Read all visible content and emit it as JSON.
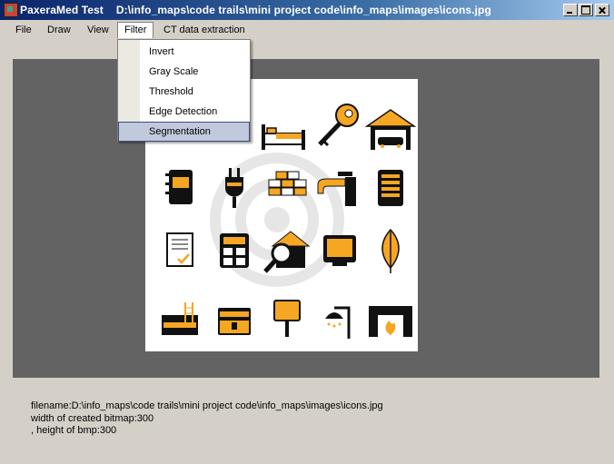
{
  "window": {
    "app_name": "PaxeraMed Test",
    "file_path": "D:\\info_maps\\code trails\\mini project code\\info_maps\\images\\icons.jpg"
  },
  "menu": {
    "items": [
      {
        "label": "File"
      },
      {
        "label": "Draw"
      },
      {
        "label": "View"
      },
      {
        "label": "Filter"
      },
      {
        "label": "CT data extraction"
      }
    ],
    "active": "Filter"
  },
  "filter_menu": {
    "items": [
      {
        "label": "Invert"
      },
      {
        "label": "Gray Scale"
      },
      {
        "label": "Threshold"
      },
      {
        "label": "Edge Detection"
      },
      {
        "label": "Segmentation"
      }
    ],
    "highlighted": "Segmentation"
  },
  "status": {
    "filename_line": "filename:D:\\info_maps\\code trails\\mini project code\\info_maps\\images\\icons.jpg",
    "width_line": "width of created bitmap:300",
    "height_line": ", height of bmp:300"
  },
  "image_icons": [
    "bed-icon",
    "key-icon",
    "garage-car-icon",
    "notebook-icon",
    "power-plug-icon",
    "bricks-icon",
    "faucet-icon",
    "radiator-icon",
    "document-check-icon",
    "calculator-icon",
    "house-search-icon",
    "television-icon",
    "leaf-icon",
    "toolbox-ladder-icon",
    "treasure-chest-icon",
    "signpost-icon",
    "shower-icon",
    "fireplace-icon"
  ],
  "colors": {
    "titlebar_start": "#0a246a",
    "titlebar_end": "#a6caf0",
    "canvas": "#636363",
    "accent_orange": "#f5a623",
    "highlight": "#c1c9dd"
  }
}
